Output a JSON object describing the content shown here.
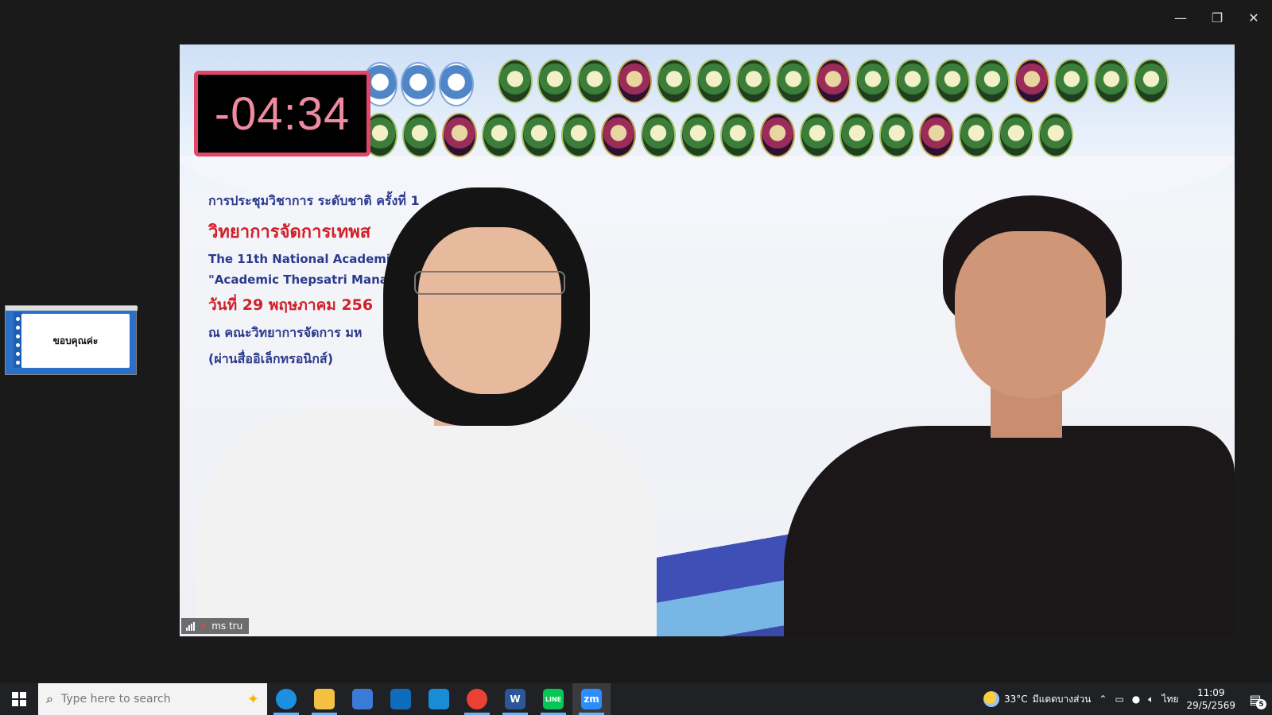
{
  "window": {
    "controls": {
      "minimize": "—",
      "restore": "❐",
      "close": "✕"
    }
  },
  "thumbnail": {
    "slide_text": "ขอบคุณค่ะ"
  },
  "video": {
    "countdown": "-04:34",
    "slide": {
      "line1": "การประชุมวิชาการ ระดับชาติ ครั้งที่ 1",
      "line2": "วิทยาการจัดการเทพส",
      "line3": "The 11th National Academic C",
      "line4": "\"Academic Thepsatri Manag",
      "line5": "วันที่ 29 พฤษภาคม 256",
      "line6": "ณ คณะวิทยาการจัดการ มห",
      "line7": "(ผ่านสื่ออิเล็กทรอนิกส์)"
    },
    "participant_name": "ms tru"
  },
  "taskbar": {
    "search_placeholder": "Type here to search",
    "apps": [
      {
        "name": "edge",
        "color": "#1d8fe0"
      },
      {
        "name": "file-explorer",
        "color": "#f3c041"
      },
      {
        "name": "microsoft-store",
        "color": "#3b7bd8"
      },
      {
        "name": "outlook",
        "color": "#0f6cbd"
      },
      {
        "name": "teams",
        "color": "#1a8bd6"
      },
      {
        "name": "chrome",
        "color": "#e94235"
      },
      {
        "name": "word",
        "color": "#2b579a"
      },
      {
        "name": "line",
        "color": "#06c755"
      },
      {
        "name": "zoom",
        "color": "#2d8cff"
      }
    ],
    "app_labels": {
      "word": "W",
      "line": "LINE",
      "zoom": "zm"
    },
    "weather": {
      "temp": "33°C",
      "desc": "มีแดดบางส่วน"
    },
    "language": "ไทย",
    "time": "11:09",
    "date": "29/5/2569",
    "notifications": "5"
  }
}
